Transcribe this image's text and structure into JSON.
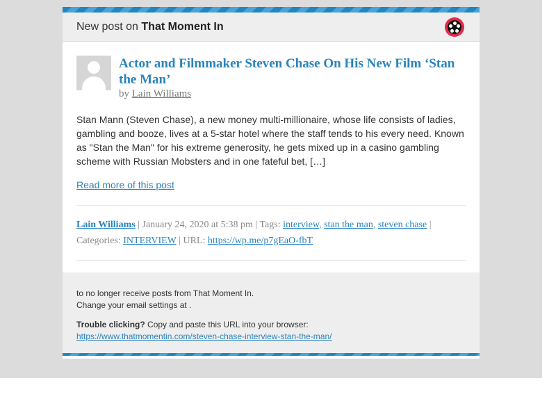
{
  "header": {
    "prefix": "New post on",
    "site_name": "That Moment In",
    "site_icon": "film-reel-icon"
  },
  "post": {
    "title": "Actor and Filmmaker Steven Chase On His New Film ‘Stan the Man’",
    "by_label": "by",
    "author": "Lain Williams",
    "excerpt": "Stan Mann (Steven Chase), a new money multi-millionaire, whose life consists of ladies, gambling and booze, lives at a 5-star hotel where the staff tends to his every need. Known as \"Stan the Man\" for his extreme generosity, he gets mixed up in a casino gambling scheme with Russian Mobsters and in one fateful bet, […]",
    "read_more": "Read more of this post"
  },
  "meta": {
    "author": "Lain Williams",
    "date": "| January 24, 2020 at 5:38 pm | Tags:",
    "tags": [
      "interview",
      "stan the man",
      "steven chase"
    ],
    "categories_label": "| Categories:",
    "category": "INTERVIEW",
    "url_label": "| URL:",
    "url": "https://wp.me/p7gEaO-fbT"
  },
  "footer": {
    "unsubscribe": "to no longer receive posts from That Moment In.",
    "settings": "Change your email settings at .",
    "trouble_bold": "Trouble clicking?",
    "trouble_text": "Copy and paste this URL into your browser:",
    "post_url": "https://www.thatmomentin.com/steven-chase-interview-stan-the-man/"
  },
  "colors": {
    "accent": "#2a84bb",
    "stripe": "#1f86bf",
    "icon_red": "#e12a4a"
  }
}
